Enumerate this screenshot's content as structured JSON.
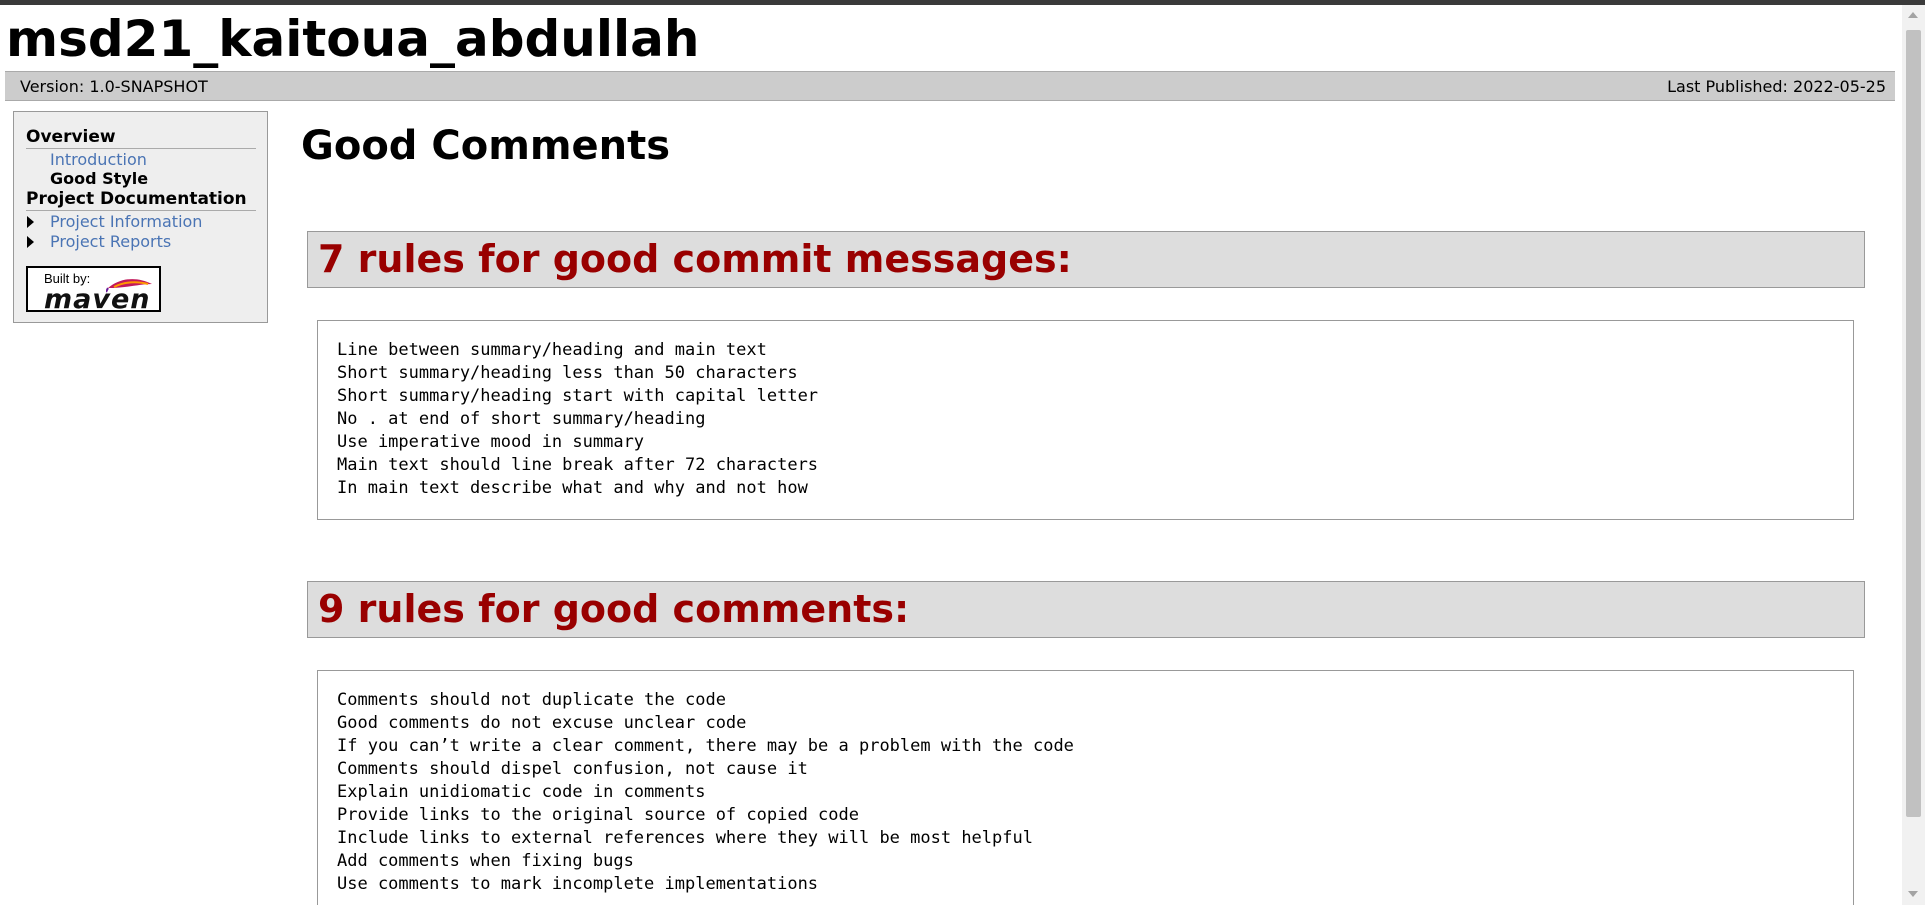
{
  "banner": {
    "title": "msd21_kaitoua_abdullah"
  },
  "breadcrumbs": {
    "version": "Version: 1.0-SNAPSHOT",
    "published": "Last Published: 2022-05-25"
  },
  "nav": {
    "overview_heading": "Overview",
    "overview_items": [
      {
        "label": "Introduction"
      },
      {
        "label": "Good Style"
      }
    ],
    "docs_heading": "Project Documentation",
    "docs_items": [
      {
        "label": "Project Information"
      },
      {
        "label": "Project Reports"
      }
    ],
    "badge": {
      "built_by": "Built by:",
      "logo_text": "maven"
    }
  },
  "main": {
    "title": "Good Comments",
    "sections": [
      {
        "heading": "7 rules for good commit messages:",
        "lines": [
          "Line between summary/heading and main text",
          "Short summary/heading less than 50 characters",
          "Short summary/heading start with capital letter",
          "No . at end of short summary/heading",
          "Use imperative mood in summary",
          "Main text should line break after 72 characters",
          "In main text describe what and why and not how"
        ]
      },
      {
        "heading": "9 rules for good comments:",
        "lines": [
          "Comments should not duplicate the code",
          "Good comments do not excuse unclear code",
          "If you can’t write a clear comment, there may be a problem with the code",
          "Comments should dispel confusion, not cause it",
          "Explain unidiomatic code in comments",
          "Provide links to the original source of copied code",
          "Include links to external references where they will be most helpful",
          "Add comments when fixing bugs",
          "Use comments to mark incomplete implementations"
        ]
      }
    ]
  },
  "colors": {
    "section_heading_text": "#990000",
    "nav_link": "#4a74b4",
    "breadcrumb_bg": "#cccccc",
    "section_heading_bg": "#dddddd"
  }
}
